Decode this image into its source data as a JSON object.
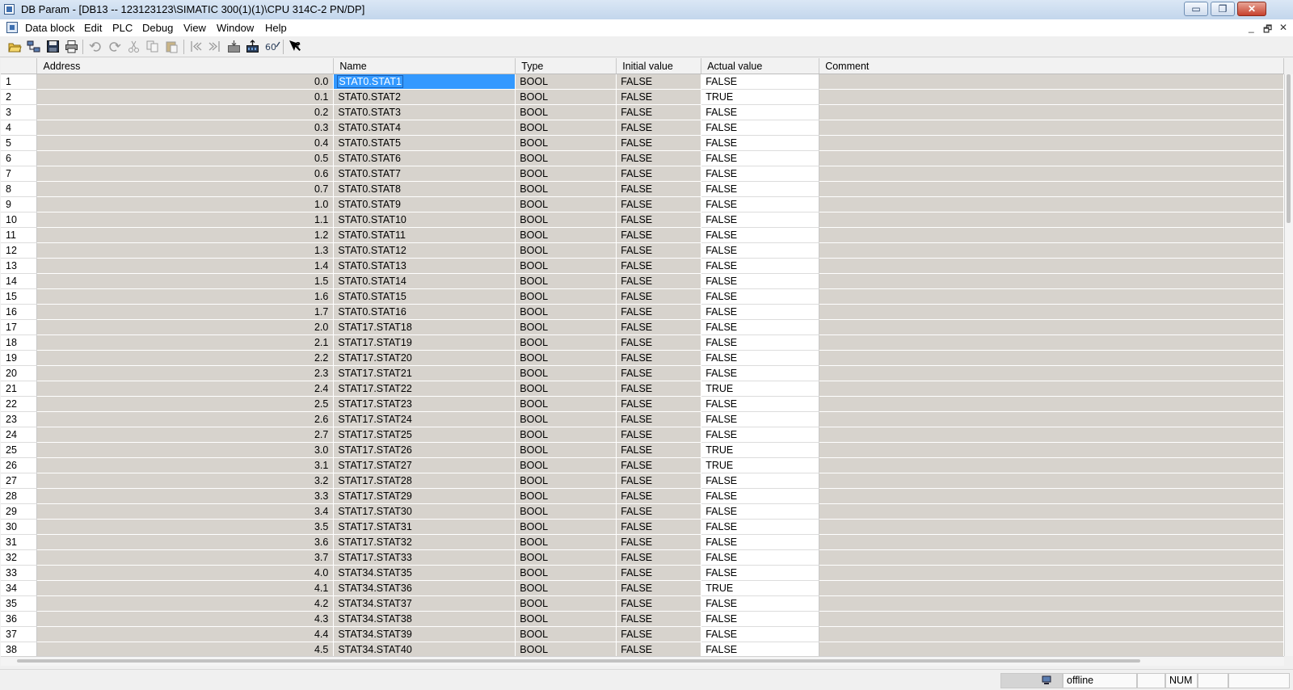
{
  "window": {
    "title": "DB Param - [DB13 -- 123123123\\SIMATIC 300(1)(1)\\CPU 314C-2 PN/DP]",
    "minimize": "▭",
    "restore": "❐",
    "close": "✕"
  },
  "menu": {
    "items": [
      "Data block",
      "Edit",
      "PLC",
      "Debug",
      "View",
      "Window",
      "Help"
    ],
    "mdi_minimize": "_",
    "mdi_restore": "🗗",
    "mdi_close": "✕"
  },
  "toolbar": {
    "buttons": [
      "open-icon",
      "network-icon",
      "save-icon",
      "print-icon",
      "undo-icon",
      "redo-icon",
      "cut-icon",
      "copy-icon",
      "paste-icon",
      "first-icon",
      "last-icon",
      "download-icon",
      "upload-icon",
      "monitor-icon",
      "help-icon"
    ]
  },
  "table": {
    "columns": [
      "",
      "Address",
      "Name",
      "Type",
      "Initial value",
      "Actual value",
      "Comment"
    ],
    "rows": [
      [
        "1",
        "0.0",
        "STAT0.STAT1",
        "BOOL",
        "FALSE",
        "FALSE",
        ""
      ],
      [
        "2",
        "0.1",
        "STAT0.STAT2",
        "BOOL",
        "FALSE",
        "TRUE",
        ""
      ],
      [
        "3",
        "0.2",
        "STAT0.STAT3",
        "BOOL",
        "FALSE",
        "FALSE",
        ""
      ],
      [
        "4",
        "0.3",
        "STAT0.STAT4",
        "BOOL",
        "FALSE",
        "FALSE",
        ""
      ],
      [
        "5",
        "0.4",
        "STAT0.STAT5",
        "BOOL",
        "FALSE",
        "FALSE",
        ""
      ],
      [
        "6",
        "0.5",
        "STAT0.STAT6",
        "BOOL",
        "FALSE",
        "FALSE",
        ""
      ],
      [
        "7",
        "0.6",
        "STAT0.STAT7",
        "BOOL",
        "FALSE",
        "FALSE",
        ""
      ],
      [
        "8",
        "0.7",
        "STAT0.STAT8",
        "BOOL",
        "FALSE",
        "FALSE",
        ""
      ],
      [
        "9",
        "1.0",
        "STAT0.STAT9",
        "BOOL",
        "FALSE",
        "FALSE",
        ""
      ],
      [
        "10",
        "1.1",
        "STAT0.STAT10",
        "BOOL",
        "FALSE",
        "FALSE",
        ""
      ],
      [
        "11",
        "1.2",
        "STAT0.STAT11",
        "BOOL",
        "FALSE",
        "FALSE",
        ""
      ],
      [
        "12",
        "1.3",
        "STAT0.STAT12",
        "BOOL",
        "FALSE",
        "FALSE",
        ""
      ],
      [
        "13",
        "1.4",
        "STAT0.STAT13",
        "BOOL",
        "FALSE",
        "FALSE",
        ""
      ],
      [
        "14",
        "1.5",
        "STAT0.STAT14",
        "BOOL",
        "FALSE",
        "FALSE",
        ""
      ],
      [
        "15",
        "1.6",
        "STAT0.STAT15",
        "BOOL",
        "FALSE",
        "FALSE",
        ""
      ],
      [
        "16",
        "1.7",
        "STAT0.STAT16",
        "BOOL",
        "FALSE",
        "FALSE",
        ""
      ],
      [
        "17",
        "2.0",
        "STAT17.STAT18",
        "BOOL",
        "FALSE",
        "FALSE",
        ""
      ],
      [
        "18",
        "2.1",
        "STAT17.STAT19",
        "BOOL",
        "FALSE",
        "FALSE",
        ""
      ],
      [
        "19",
        "2.2",
        "STAT17.STAT20",
        "BOOL",
        "FALSE",
        "FALSE",
        ""
      ],
      [
        "20",
        "2.3",
        "STAT17.STAT21",
        "BOOL",
        "FALSE",
        "FALSE",
        ""
      ],
      [
        "21",
        "2.4",
        "STAT17.STAT22",
        "BOOL",
        "FALSE",
        "TRUE",
        ""
      ],
      [
        "22",
        "2.5",
        "STAT17.STAT23",
        "BOOL",
        "FALSE",
        "FALSE",
        ""
      ],
      [
        "23",
        "2.6",
        "STAT17.STAT24",
        "BOOL",
        "FALSE",
        "FALSE",
        ""
      ],
      [
        "24",
        "2.7",
        "STAT17.STAT25",
        "BOOL",
        "FALSE",
        "FALSE",
        ""
      ],
      [
        "25",
        "3.0",
        "STAT17.STAT26",
        "BOOL",
        "FALSE",
        "TRUE",
        ""
      ],
      [
        "26",
        "3.1",
        "STAT17.STAT27",
        "BOOL",
        "FALSE",
        "TRUE",
        ""
      ],
      [
        "27",
        "3.2",
        "STAT17.STAT28",
        "BOOL",
        "FALSE",
        "FALSE",
        ""
      ],
      [
        "28",
        "3.3",
        "STAT17.STAT29",
        "BOOL",
        "FALSE",
        "FALSE",
        ""
      ],
      [
        "29",
        "3.4",
        "STAT17.STAT30",
        "BOOL",
        "FALSE",
        "FALSE",
        ""
      ],
      [
        "30",
        "3.5",
        "STAT17.STAT31",
        "BOOL",
        "FALSE",
        "FALSE",
        ""
      ],
      [
        "31",
        "3.6",
        "STAT17.STAT32",
        "BOOL",
        "FALSE",
        "FALSE",
        ""
      ],
      [
        "32",
        "3.7",
        "STAT17.STAT33",
        "BOOL",
        "FALSE",
        "FALSE",
        ""
      ],
      [
        "33",
        "4.0",
        "STAT34.STAT35",
        "BOOL",
        "FALSE",
        "FALSE",
        ""
      ],
      [
        "34",
        "4.1",
        "STAT34.STAT36",
        "BOOL",
        "FALSE",
        "TRUE",
        ""
      ],
      [
        "35",
        "4.2",
        "STAT34.STAT37",
        "BOOL",
        "FALSE",
        "FALSE",
        ""
      ],
      [
        "36",
        "4.3",
        "STAT34.STAT38",
        "BOOL",
        "FALSE",
        "FALSE",
        ""
      ],
      [
        "37",
        "4.4",
        "STAT34.STAT39",
        "BOOL",
        "FALSE",
        "FALSE",
        ""
      ],
      [
        "38",
        "4.5",
        "STAT34.STAT40",
        "BOOL",
        "FALSE",
        "FALSE",
        ""
      ]
    ],
    "selected_row": 1,
    "selected_column": "Name"
  },
  "status": {
    "connection_icon": "computer-icon",
    "connection": "offline",
    "num_lock": "NUM"
  },
  "colors": {
    "selection": "#3399ff",
    "grid_background": "#d7d3cd",
    "editable_cell": "#ffffff"
  }
}
